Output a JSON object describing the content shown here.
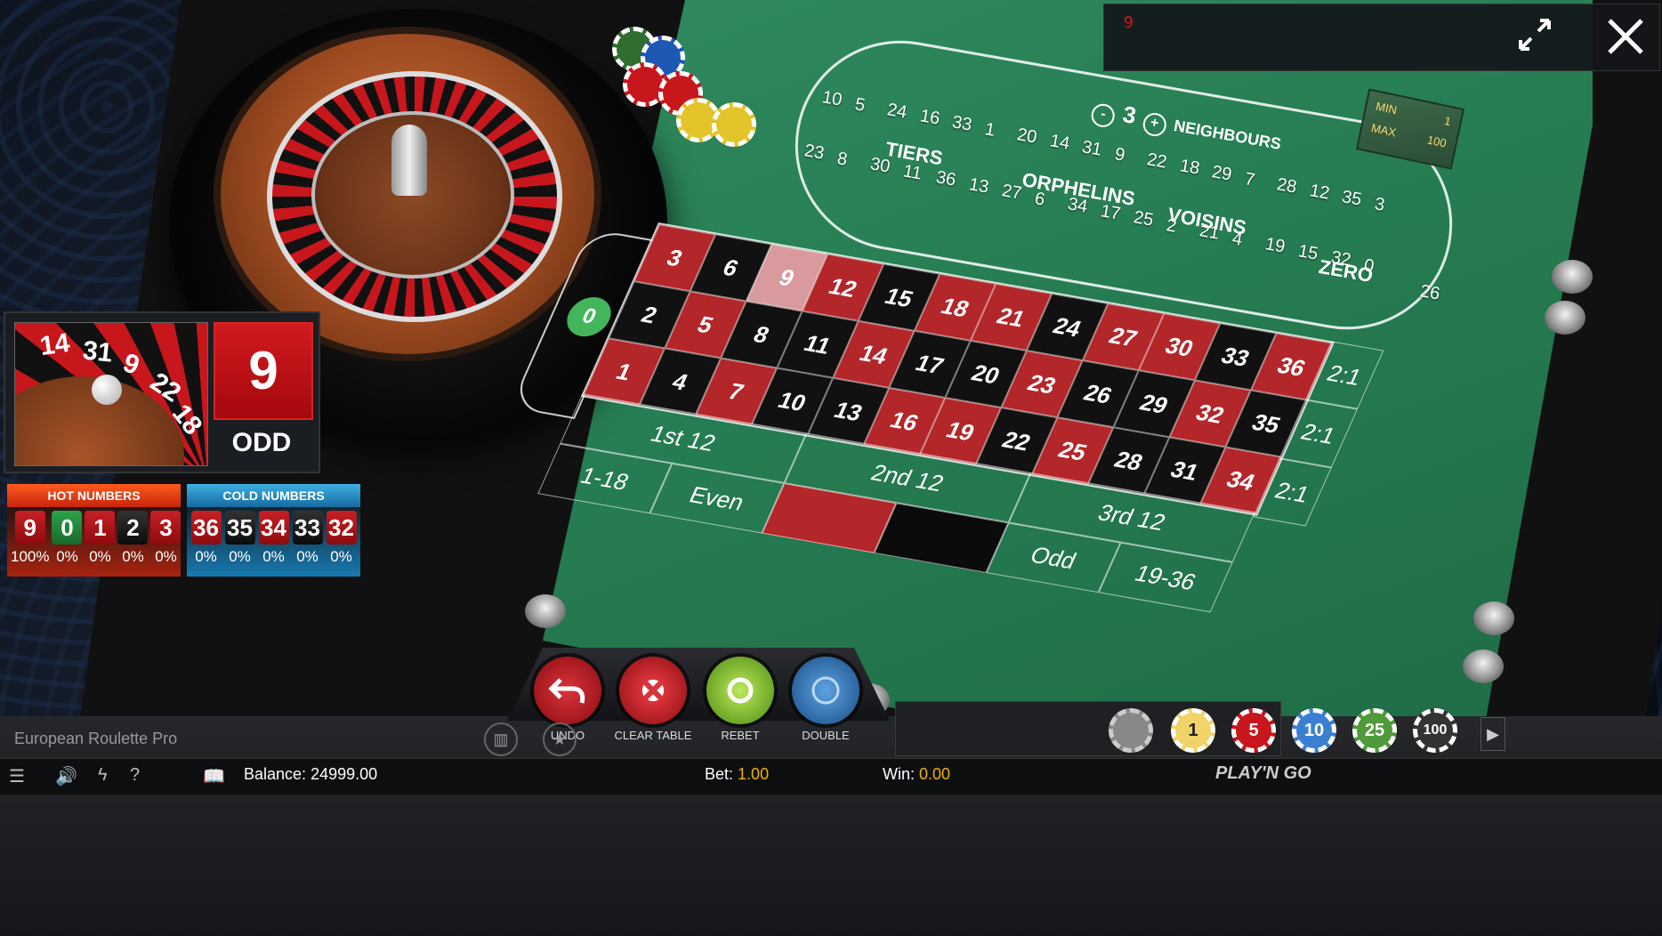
{
  "topbar": {
    "last_number": "9"
  },
  "racetrack": {
    "numbers_row_top": [
      "10",
      "5",
      "24",
      "16",
      "33",
      "1",
      "20",
      "14",
      "31",
      "9",
      "22",
      "18",
      "29",
      "7",
      "28",
      "12",
      "35",
      "3"
    ],
    "numbers_row_bottom": [
      "23",
      "8",
      "30",
      "11",
      "36",
      "13",
      "27",
      "6",
      "34",
      "17",
      "25",
      "2",
      "21",
      "4",
      "19",
      "15",
      "32",
      "0"
    ],
    "end_right": "26",
    "sections": [
      "TIERS",
      "ORPHELINS",
      "VOISINS",
      "ZERO"
    ],
    "neighbours_label": "NEIGHBOURS",
    "neighbours_count": "3",
    "minus": "-",
    "plus": "+"
  },
  "limits": {
    "min_label": "MIN",
    "min_value": "1",
    "max_label": "MAX",
    "max_value": "100"
  },
  "board": {
    "zero": "0",
    "rows": [
      [
        {
          "n": "3",
          "c": "red"
        },
        {
          "n": "6",
          "c": "black"
        },
        {
          "n": "9",
          "c": "hl"
        },
        {
          "n": "12",
          "c": "red"
        },
        {
          "n": "15",
          "c": "black"
        },
        {
          "n": "18",
          "c": "red"
        },
        {
          "n": "21",
          "c": "red"
        },
        {
          "n": "24",
          "c": "black"
        },
        {
          "n": "27",
          "c": "red"
        },
        {
          "n": "30",
          "c": "red"
        },
        {
          "n": "33",
          "c": "black"
        },
        {
          "n": "36",
          "c": "red"
        }
      ],
      [
        {
          "n": "2",
          "c": "black"
        },
        {
          "n": "5",
          "c": "red"
        },
        {
          "n": "8",
          "c": "black"
        },
        {
          "n": "11",
          "c": "black"
        },
        {
          "n": "14",
          "c": "red"
        },
        {
          "n": "17",
          "c": "black"
        },
        {
          "n": "20",
          "c": "black"
        },
        {
          "n": "23",
          "c": "red"
        },
        {
          "n": "26",
          "c": "black"
        },
        {
          "n": "29",
          "c": "black"
        },
        {
          "n": "32",
          "c": "red"
        },
        {
          "n": "35",
          "c": "black"
        }
      ],
      [
        {
          "n": "1",
          "c": "red"
        },
        {
          "n": "4",
          "c": "black"
        },
        {
          "n": "7",
          "c": "red"
        },
        {
          "n": "10",
          "c": "black"
        },
        {
          "n": "13",
          "c": "black"
        },
        {
          "n": "16",
          "c": "red"
        },
        {
          "n": "19",
          "c": "red"
        },
        {
          "n": "22",
          "c": "black"
        },
        {
          "n": "25",
          "c": "red"
        },
        {
          "n": "28",
          "c": "black"
        },
        {
          "n": "31",
          "c": "black"
        },
        {
          "n": "34",
          "c": "red"
        }
      ]
    ],
    "columns": [
      "2:1",
      "2:1",
      "2:1"
    ],
    "dozens": [
      "1st 12",
      "2nd 12",
      "3rd 12"
    ],
    "outside": [
      "1-18",
      "Even",
      "",
      "",
      "Odd",
      "19-36"
    ]
  },
  "result": {
    "number": "9",
    "parity": "ODD",
    "zoom_numbers": [
      "14",
      "31",
      "9",
      "22",
      "18"
    ]
  },
  "hot": {
    "title": "HOT NUMBERS",
    "items": [
      {
        "n": "9",
        "c": "red",
        "p": "100%"
      },
      {
        "n": "0",
        "c": "green",
        "p": "0%"
      },
      {
        "n": "1",
        "c": "red",
        "p": "0%"
      },
      {
        "n": "2",
        "c": "black",
        "p": "0%"
      },
      {
        "n": "3",
        "c": "red",
        "p": "0%"
      }
    ]
  },
  "cold": {
    "title": "COLD NUMBERS",
    "items": [
      {
        "n": "36",
        "c": "red",
        "p": "0%"
      },
      {
        "n": "35",
        "c": "black",
        "p": "0%"
      },
      {
        "n": "34",
        "c": "red",
        "p": "0%"
      },
      {
        "n": "33",
        "c": "black",
        "p": "0%"
      },
      {
        "n": "32",
        "c": "red",
        "p": "0%"
      }
    ]
  },
  "controls": {
    "undo": "UNDO",
    "clear": "CLEAR TABLE",
    "rebet": "REBET",
    "double": "DOUBLE"
  },
  "chips": [
    "1",
    "5",
    "10",
    "25",
    "100"
  ],
  "footer": {
    "game_title": "European Roulette Pro",
    "balance_label": "Balance:",
    "balance_value": "24999.00",
    "bet_label": "Bet:",
    "bet_value": "1.00",
    "win_label": "Win:",
    "win_value": "0.00",
    "brand": "PLAY'N GO",
    "help": "?"
  },
  "colors": {
    "felt": "#2a8254",
    "red": "#b3262a",
    "black": "#111111",
    "accent": "#f0b000"
  }
}
